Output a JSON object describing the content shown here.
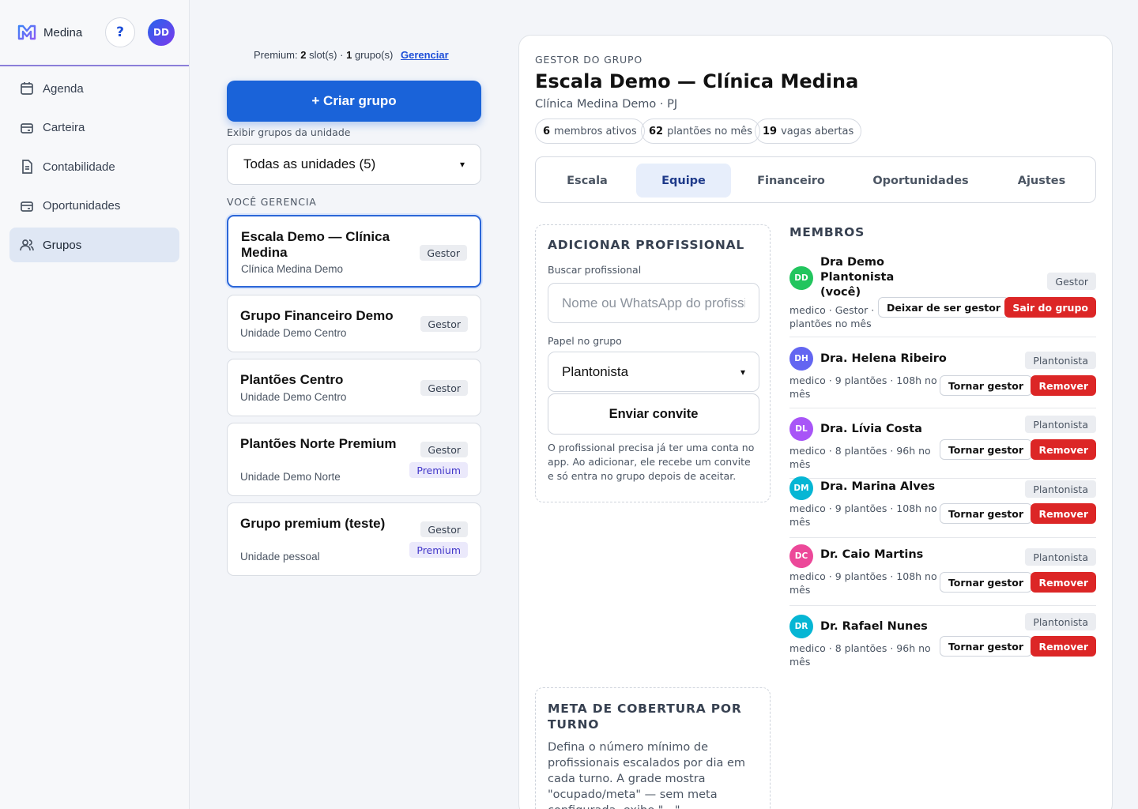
{
  "app": {
    "name": "Medina",
    "help_label": "?",
    "user_initials": "DD"
  },
  "sidebar": {
    "items": [
      {
        "label": "Agenda",
        "icon": "calendar-icon"
      },
      {
        "label": "Carteira",
        "icon": "wallet-icon"
      },
      {
        "label": "Contabilidade",
        "icon": "document-icon"
      },
      {
        "label": "Oportunidades",
        "icon": "briefcase-icon"
      },
      {
        "label": "Grupos",
        "icon": "users-icon",
        "active": true
      }
    ]
  },
  "groups_panel": {
    "premium_prefix": "Premium:",
    "slots_count": "2",
    "slots_label": "slot(s) ·",
    "groups_count": "1",
    "groups_label": "grupo(s)",
    "manage_link": "Gerenciar",
    "create_button": "+ Criar grupo",
    "unit_filter_label": "Exibir grupos da unidade",
    "unit_filter_value": "Todas as unidades (5)",
    "managing_heading": "VOCÊ GERENCIA",
    "groups": [
      {
        "title": "Escala Demo — Clínica Medina",
        "subtitle": "Clínica Medina Demo",
        "badges": [
          "Gestor"
        ],
        "active": true
      },
      {
        "title": "Grupo Financeiro Demo",
        "subtitle": "Unidade Demo Centro",
        "badges": [
          "Gestor"
        ]
      },
      {
        "title": "Plantões Centro",
        "subtitle": "Unidade Demo Centro",
        "badges": [
          "Gestor"
        ]
      },
      {
        "title": "Plantões Norte Premium",
        "subtitle": "Unidade Demo Norte",
        "badges": [
          "Gestor",
          "Premium"
        ]
      },
      {
        "title": "Grupo premium (teste)",
        "subtitle": "Unidade pessoal",
        "badges": [
          "Gestor",
          "Premium"
        ]
      }
    ]
  },
  "detail": {
    "eyebrow": "GESTOR DO GRUPO",
    "title": "Escala Demo — Clínica Medina",
    "subtitle": "Clínica Medina Demo · PJ",
    "stats": [
      {
        "value": "6",
        "label": "membros ativos"
      },
      {
        "value": "62",
        "label": "plantões no mês"
      },
      {
        "value": "19",
        "label": "vagas abertas"
      }
    ],
    "tabs": [
      "Escala",
      "Equipe",
      "Financeiro",
      "Oportunidades",
      "Ajustes"
    ],
    "active_tab": "Equipe",
    "add_professional": {
      "title": "ADICIONAR PROFISSIONAL",
      "search_label": "Buscar profissional",
      "search_placeholder": "Nome ou WhatsApp do profissional",
      "role_label": "Papel no grupo",
      "role_value": "Plantonista",
      "send_button": "Enviar convite",
      "help": "O profissional precisa já ter uma conta no app. Ao adicionar, ele recebe um convite e só entra no grupo depois de aceitar."
    },
    "coverage": {
      "title": "META DE COBERTURA POR TURNO",
      "text": "Defina o número mínimo de profissionais escalados por dia em cada turno. A grade mostra \"ocupado/meta\" — sem meta configurada, exibe \"—\"."
    },
    "members": {
      "title": "MEMBROS",
      "list": [
        {
          "initials": "DD",
          "name": "Dra Demo Plantonista (você)",
          "meta": "medico · Gestor · 0 plantões no mês",
          "role": "Gestor",
          "action1": "Deixar de ser gestor",
          "action2": "Sair do grupo",
          "color": "#22c55e"
        },
        {
          "initials": "DH",
          "name": "Dra. Helena Ribeiro",
          "meta": "medico · 9 plantões · 108h no mês",
          "role": "Plantonista",
          "action1": "Tornar gestor",
          "action2": "Remover",
          "color": "#6366f1"
        },
        {
          "initials": "DL",
          "name": "Dra. Lívia Costa",
          "meta": "medico · 8 plantões · 96h no mês",
          "role": "Plantonista",
          "action1": "Tornar gestor",
          "action2": "Remover",
          "color": "#a855f7"
        },
        {
          "initials": "DM",
          "name": "Dra. Marina Alves",
          "meta": "medico · 9 plantões · 108h no mês",
          "role": "Plantonista",
          "action1": "Tornar gestor",
          "action2": "Remover",
          "color": "#06b6d4"
        },
        {
          "initials": "DC",
          "name": "Dr. Caio Martins",
          "meta": "medico · 9 plantões · 108h no mês",
          "role": "Plantonista",
          "action1": "Tornar gestor",
          "action2": "Remover",
          "color": "#ec4899"
        },
        {
          "initials": "DR",
          "name": "Dr. Rafael Nunes",
          "meta": "medico · 8 plantões · 96h no mês",
          "role": "Plantonista",
          "action1": "Tornar gestor",
          "action2": "Remover",
          "color": "#06b6d4"
        }
      ]
    }
  }
}
